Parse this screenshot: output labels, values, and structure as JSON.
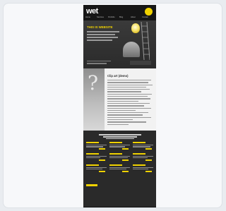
{
  "page": {
    "logo_text": "wet",
    "nav_items": [
      "Home",
      "Services",
      "Portfolio",
      "Blog",
      "About",
      "Contact"
    ],
    "hero_title": "THIS IS WEBSITE",
    "mid_title": "Clip art (demo)"
  },
  "colors": {
    "accent": "#f0d200",
    "dark_bg": "#2a2a2a",
    "light_bg": "#f2f2f2"
  }
}
